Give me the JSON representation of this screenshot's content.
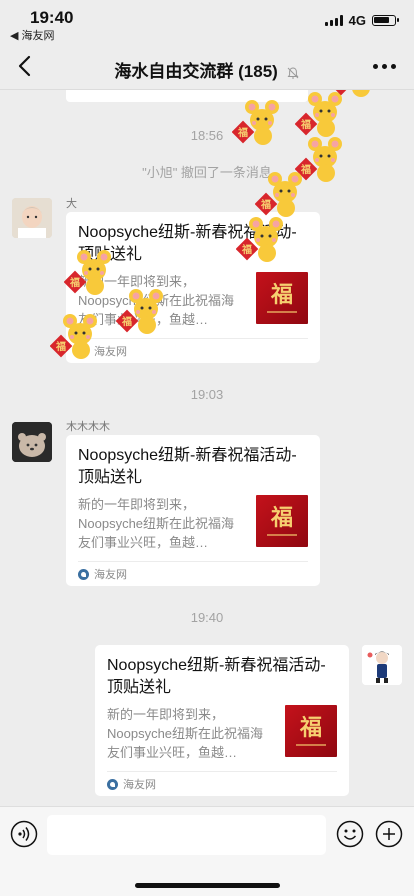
{
  "status_bar": {
    "time": "19:40",
    "back_app": "◀ 海友网",
    "network": "4G"
  },
  "header": {
    "title": "海水自由交流群 (185)"
  },
  "chat": {
    "time_1": "18:56",
    "recall_notice": "\"小旭\" 撤回了一条消息",
    "time_2": "19:03",
    "time_3": "19:40",
    "messages": [
      {
        "sender": "大",
        "card": {
          "title": "Noopsyche纽斯-新春祝福活动-顶贴送礼",
          "description": "新的一年即将到来，Noopsyche纽斯在此祝福海友们事业兴旺，鱼越…",
          "thumb_text": "福",
          "source": "海友网"
        }
      },
      {
        "sender": "木木木木",
        "card": {
          "title": "Noopsyche纽斯-新春祝福活动-顶贴送礼",
          "description": "新的一年即将到来，Noopsyche纽斯在此祝福海友们事业兴旺，鱼越…",
          "thumb_text": "福",
          "source": "海友网"
        }
      },
      {
        "sender": "",
        "card": {
          "title": "Noopsyche纽斯-新春祝福活动-顶贴送礼",
          "description": "新的一年即将到来，Noopsyche纽斯在此祝福海友们事业兴旺，鱼越…",
          "thumb_text": "福",
          "source": "海友网"
        }
      }
    ],
    "sticker_label": "福"
  },
  "colors": {
    "background": "#ededed",
    "card": "#ffffff",
    "thumb_red": "#c4121b",
    "mouse_yellow": "#f8c93a"
  }
}
